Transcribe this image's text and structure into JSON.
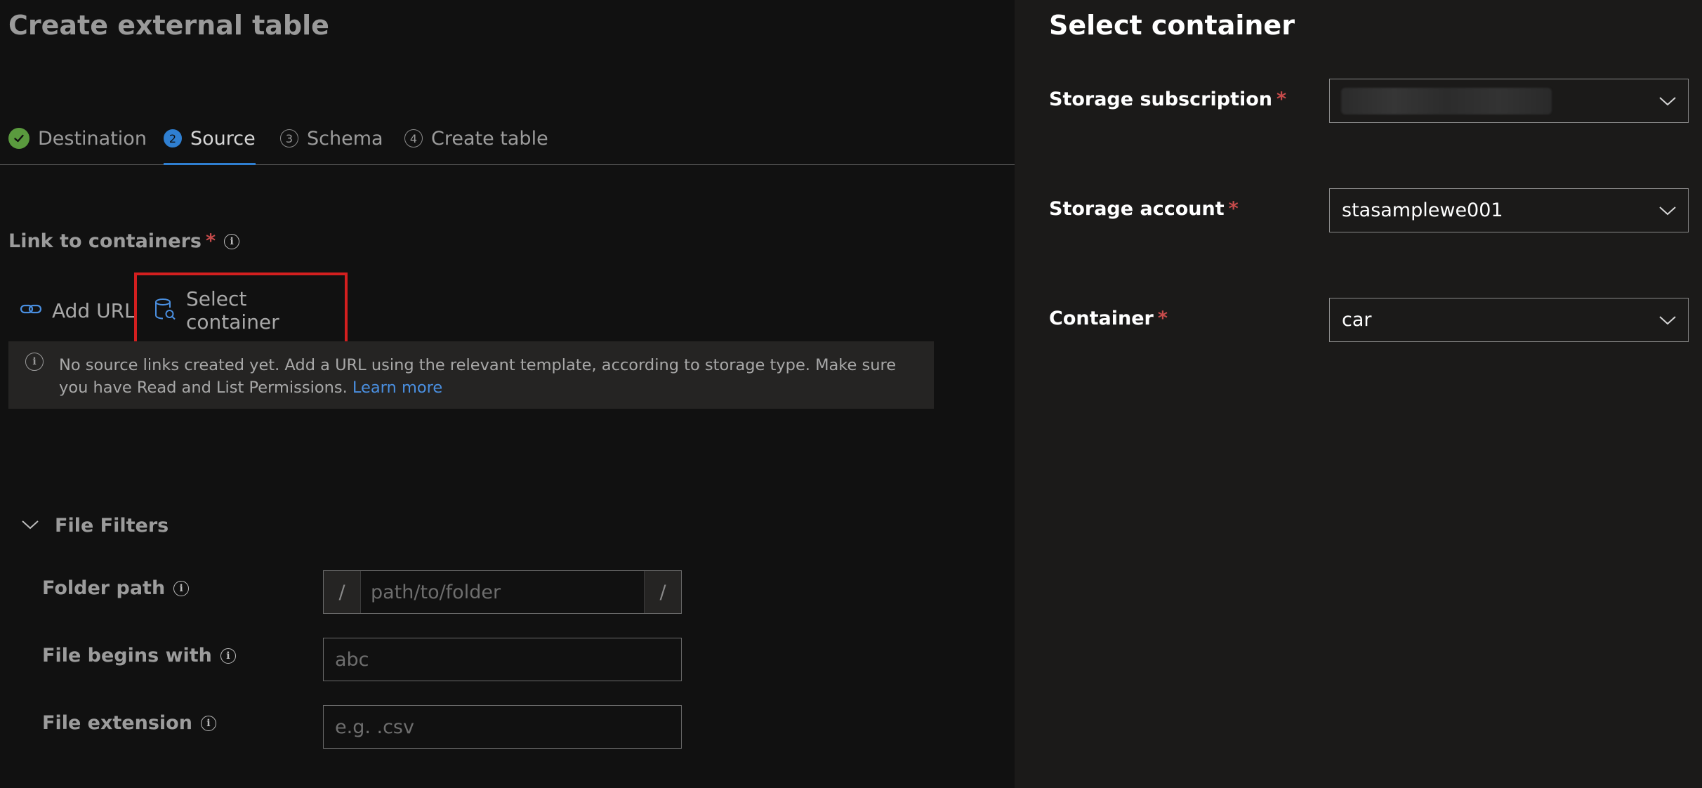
{
  "page": {
    "title": "Create external table"
  },
  "steps": [
    {
      "label": "Destination",
      "state": "completed",
      "number": ""
    },
    {
      "label": "Source",
      "state": "active",
      "number": "2"
    },
    {
      "label": "Schema",
      "state": "pending",
      "number": "3"
    },
    {
      "label": "Create table",
      "state": "pending",
      "number": "4"
    }
  ],
  "link": {
    "label": "Link to containers",
    "required_mark": "*",
    "add_url_label": "Add URL",
    "select_container_label": "Select container"
  },
  "info_bar": {
    "message": "No source links created yet. Add a URL using the relevant template, according to storage type. Make sure you have Read and List Permissions.",
    "link_text": "Learn more"
  },
  "filters": {
    "header": "File Filters",
    "folder_path": {
      "label": "Folder path",
      "prefix": "/",
      "suffix": "/",
      "placeholder": "path/to/folder"
    },
    "file_begins_with": {
      "label": "File begins with",
      "placeholder": "abc"
    },
    "file_extension": {
      "label": "File extension",
      "placeholder": "e.g. .csv"
    }
  },
  "panel": {
    "title": "Select container",
    "required_mark": "*",
    "storage_subscription": {
      "label": "Storage subscription",
      "value": ""
    },
    "storage_account": {
      "label": "Storage account",
      "value": "stasamplewe001"
    },
    "container": {
      "label": "Container",
      "value": "car"
    }
  },
  "colors": {
    "accent": "#2f7fd1",
    "success": "#5a9a3e",
    "required": "#c74b4b",
    "highlight": "#d31f1f",
    "link": "#4a8fe0"
  },
  "icons": [
    "check-icon",
    "info-icon",
    "link-icon",
    "container-icon",
    "chevron-down-icon"
  ]
}
